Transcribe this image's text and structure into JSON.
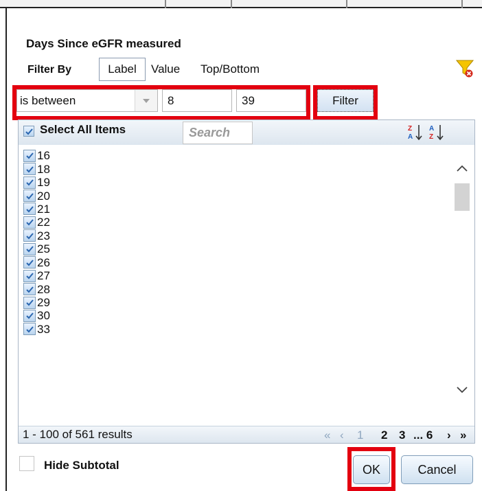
{
  "dialog": {
    "title": "Days Since eGFR measured"
  },
  "filter_by": {
    "label": "Filter By",
    "tabs": [
      {
        "label": "Label",
        "selected": true
      },
      {
        "label": "Value",
        "selected": false
      },
      {
        "label": "Top/Bottom",
        "selected": false
      }
    ],
    "clear_filter_icon": "funnel-clear-icon"
  },
  "condition": {
    "operator": "is between",
    "from": "8",
    "to": "39",
    "filter_button": "Filter"
  },
  "list": {
    "select_all_label": "Select All Items",
    "search_placeholder": "Search",
    "sort_icons": [
      "sort-az-icon",
      "sort-za-icon"
    ],
    "items": [
      {
        "label": "16",
        "checked": true
      },
      {
        "label": "18",
        "checked": true
      },
      {
        "label": "19",
        "checked": true
      },
      {
        "label": "20",
        "checked": true
      },
      {
        "label": "21",
        "checked": true
      },
      {
        "label": "22",
        "checked": true
      },
      {
        "label": "23",
        "checked": true
      },
      {
        "label": "25",
        "checked": true
      },
      {
        "label": "26",
        "checked": true
      },
      {
        "label": "27",
        "checked": true
      },
      {
        "label": "28",
        "checked": true
      },
      {
        "label": "29",
        "checked": true
      },
      {
        "label": "30",
        "checked": true
      },
      {
        "label": "33",
        "checked": true
      }
    ],
    "results_text": "1 - 100 of 561 results",
    "pager": {
      "first": "«",
      "prev": "‹",
      "page_1": "1",
      "page_2": "2",
      "page_3": "3",
      "ellipsis_last": "... 6",
      "next": "›",
      "last": "»"
    }
  },
  "bottom": {
    "hide_subtotal_label": "Hide Subtotal",
    "ok_label": "OK",
    "cancel_label": "Cancel"
  },
  "colors": {
    "highlight_red": "#e3000f",
    "panel_border": "#a9b6c6",
    "pager_disabled": "#8fa6bf"
  }
}
